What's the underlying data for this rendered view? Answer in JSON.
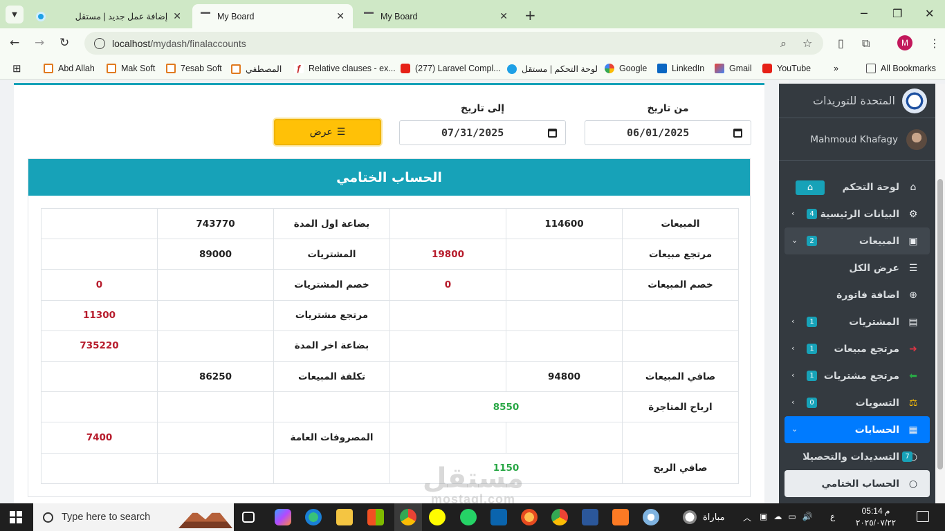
{
  "browser": {
    "tabs": [
      {
        "title": "إضافة عمل جديد | مستقل",
        "active": false
      },
      {
        "title": "My Board",
        "active": true
      },
      {
        "title": "My Board",
        "active": false
      }
    ],
    "url_host": "localhost",
    "url_path": "/mydash/finalaccounts",
    "profile_initial": "M",
    "bookmarks": [
      "Abd Allah",
      "Mak Soft",
      "7esab Soft",
      "المصطفي",
      "Relative clauses - ex...",
      "(277) Laravel Compl...",
      "لوحة التحكم | مستقل",
      "Google",
      "LinkedIn",
      "Gmail",
      "YouTube"
    ],
    "all_bookmarks": "All Bookmarks"
  },
  "filters": {
    "from_label": "من تاريخ",
    "from_value": "06/01/2025",
    "to_label": "إلى تاريخ",
    "to_value": "07/31/2025",
    "show_button": "عرض"
  },
  "report": {
    "title": "الحساب الختامي",
    "rows": [
      [
        {
          "t": "المبيعات"
        },
        {
          "t": "114600"
        },
        {
          "t": ""
        },
        {
          "t": "بضاعة اول المدة"
        },
        {
          "t": "743770"
        },
        {
          "t": ""
        }
      ],
      [
        {
          "t": "مرتجع مبيعات"
        },
        {
          "t": ""
        },
        {
          "t": "19800",
          "c": "red"
        },
        {
          "t": "المشتريات"
        },
        {
          "t": "89000"
        },
        {
          "t": ""
        }
      ],
      [
        {
          "t": "خصم المبيعات"
        },
        {
          "t": ""
        },
        {
          "t": "0",
          "c": "red"
        },
        {
          "t": "خصم المشتريات"
        },
        {
          "t": ""
        },
        {
          "t": "0",
          "c": "red"
        }
      ],
      [
        {
          "t": ""
        },
        {
          "t": ""
        },
        {
          "t": ""
        },
        {
          "t": "مرتجع مشتريات"
        },
        {
          "t": ""
        },
        {
          "t": "11300",
          "c": "red"
        }
      ],
      [
        {
          "t": ""
        },
        {
          "t": ""
        },
        {
          "t": ""
        },
        {
          "t": "بضاعة اخر المدة"
        },
        {
          "t": ""
        },
        {
          "t": "735220",
          "c": "red"
        }
      ],
      [
        {
          "t": "صافي المبيعات"
        },
        {
          "t": "94800"
        },
        {
          "t": ""
        },
        {
          "t": "تكلفة المبيعات"
        },
        {
          "t": "86250"
        },
        {
          "t": ""
        }
      ],
      [
        {
          "t": "ارباح المتاجرة"
        },
        {
          "t": "8550",
          "c": "green",
          "span": 2
        },
        {
          "t": ""
        },
        {
          "t": ""
        },
        {
          "t": ""
        }
      ],
      [
        {
          "t": ""
        },
        {
          "t": ""
        },
        {
          "t": ""
        },
        {
          "t": "المصروفات العامة"
        },
        {
          "t": ""
        },
        {
          "t": "7400",
          "c": "red"
        }
      ],
      [
        {
          "t": "صافي الربح"
        },
        {
          "t": "1150",
          "c": "green",
          "span": 2
        },
        {
          "t": ""
        },
        {
          "t": ""
        },
        {
          "t": ""
        }
      ]
    ]
  },
  "sidebar": {
    "brand": "المتحدة للتوريدات",
    "user": "Mahmoud Khafagy",
    "items": [
      {
        "label": "لوحة التحكم",
        "icon": "home-icon",
        "glyph": "⌂",
        "home_badge": true
      },
      {
        "label": "البيانات الرئيسية",
        "icon": "gears-icon",
        "glyph": "⚙",
        "badge": "4",
        "chevron": "›"
      },
      {
        "label": "المبيعات",
        "icon": "shopping-bag-icon",
        "glyph": "▣",
        "badge": "2",
        "chevron": "⌄",
        "state": "open"
      },
      {
        "label": "عرض الكل",
        "icon": "list-icon",
        "glyph": "☰",
        "sub": true
      },
      {
        "label": "اضافة فاتورة",
        "icon": "plus-circle-icon",
        "glyph": "⊕",
        "sub": true
      },
      {
        "label": "المشتريات",
        "icon": "box-icon",
        "glyph": "▤",
        "badge": "1",
        "chevron": "›"
      },
      {
        "label": "مرتجع مبيعات",
        "icon": "arrow-right-icon",
        "glyph": "➜",
        "badge": "1",
        "chevron": "›",
        "icon_color": "#dc3545"
      },
      {
        "label": "مرتجع مشتريات",
        "icon": "arrow-left-icon",
        "glyph": "⬅",
        "badge": "1",
        "chevron": "›",
        "icon_color": "#28a745"
      },
      {
        "label": "التسويات",
        "icon": "balance-scale-icon",
        "glyph": "⚖",
        "badge": "0",
        "chevron": "›",
        "icon_color": "#ffc107"
      },
      {
        "label": "الحسابات",
        "icon": "calculator-icon",
        "glyph": "▦",
        "chevron": "⌄",
        "state": "primary"
      },
      {
        "label": "التسديدات والتحصيلا",
        "icon": "circle-icon",
        "glyph": "○",
        "badge": "7",
        "sub": true
      },
      {
        "label": "الحساب الختامي",
        "icon": "circle-icon",
        "glyph": "○",
        "state": "light"
      }
    ]
  },
  "watermark": {
    "line1": "مستقل",
    "line2": "mostaql.com"
  },
  "taskbar": {
    "search_placeholder": "Type here to search",
    "weather": "مباراة",
    "time": "م 05:14",
    "date": "٢٠٢٥/٠٧/٢٢",
    "lang": "ع"
  }
}
